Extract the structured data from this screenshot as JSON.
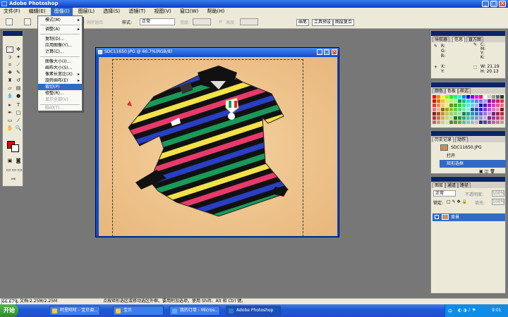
{
  "window": {
    "title": "Adobe Photoshop"
  },
  "menu": [
    "文件(F)",
    "编辑(E)",
    "图像(I)",
    "图层(L)",
    "选择(S)",
    "滤镜(T)",
    "视图(V)",
    "窗口(W)",
    "帮助(H)"
  ],
  "options": {
    "anti_alias": "消除锯齿",
    "style_label": "样式:",
    "style_value": "正常",
    "width_label": "宽度:",
    "height_label": "高度:",
    "wells": [
      "画笔",
      "工具预设",
      "图层复合"
    ]
  },
  "image_menu": {
    "items": [
      {
        "label": "模式(M)",
        "disabled": false,
        "sub": true
      },
      {
        "label": "调整(A)",
        "disabled": false,
        "sub": true
      },
      {
        "label": "复制(D)...",
        "disabled": false,
        "sub": false
      },
      {
        "label": "应用图像(Y)...",
        "disabled": false,
        "sub": false
      },
      {
        "label": "计算(C)...",
        "disabled": false,
        "sub": false
      },
      {
        "label": "图像大小(I)...",
        "disabled": false,
        "sub": false
      },
      {
        "label": "画布大小(S)...",
        "disabled": false,
        "sub": false
      },
      {
        "label": "像素长宽比(X)",
        "disabled": false,
        "sub": true
      },
      {
        "label": "旋转画布(E)",
        "disabled": false,
        "sub": true
      },
      {
        "label": "裁切(P)",
        "disabled": false,
        "sub": false,
        "highlight": true
      },
      {
        "label": "修整(R)...",
        "disabled": false,
        "sub": false
      },
      {
        "label": "显示全部(V)",
        "disabled": true,
        "sub": false
      },
      {
        "label": "陷印(T)...",
        "disabled": true,
        "sub": false
      }
    ]
  },
  "document": {
    "title": "SDC11650.JPG @ 66.7%(RGB/8)"
  },
  "info_panel": {
    "tabs": [
      "导航器",
      "信息",
      "直方图"
    ],
    "rows": [
      "R:",
      "G:",
      "B:",
      "C:",
      "M:",
      "Y:",
      "K:",
      "X:",
      "Y:",
      "W: 21.19",
      "H: 20.13"
    ]
  },
  "color_panel": {
    "tabs": [
      "颜色",
      "色板",
      "样式"
    ]
  },
  "history_panel": {
    "tabs": [
      "历史记录",
      "动作"
    ],
    "snapshot": "SDC11650.JPG",
    "items": [
      "打开",
      "矩形选框"
    ]
  },
  "layers_panel": {
    "tabs": [
      "图层",
      "通道",
      "路径"
    ],
    "mode": "正常",
    "opacity_label": "不透明度:",
    "opacity": "100%",
    "lock_label": "锁定:",
    "fill_label": "填充:",
    "fill": "100%",
    "layer_name": "背景"
  },
  "status": {
    "zoom": "66.67%",
    "doc": "文档:2.25M/2.25M",
    "hint": "点按矩形选区或移动选区外框。要用附加选项，使用 Shift、Alt 和 Ctrl 键。"
  },
  "taskbar": {
    "start": "开始",
    "tasks": [
      "阿里旺旺 - 宝贝调...",
      "宝贝",
      "我的订单 - Micros...",
      "Adobe Photoshop"
    ],
    "clock": "9:01",
    "lang": "中"
  },
  "colors": {
    "accent": "#316ac5",
    "title": "#0a246a"
  }
}
